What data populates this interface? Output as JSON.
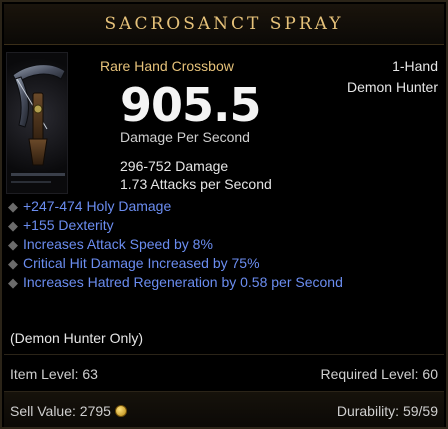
{
  "item": {
    "name": "Sacrosanct Spray",
    "subtype": "Rare Hand Crossbow",
    "handedness": "1-Hand",
    "class": "Demon Hunter",
    "dps": "905.5",
    "dps_label": "Damage Per Second",
    "damage_range": "296-752 Damage",
    "attacks_per_second": "1.73 Attacks per Second",
    "affixes": [
      "+247-474 Holy Damage",
      "+155 Dexterity",
      "Increases Attack Speed by 8%",
      "Critical Hit Damage Increased by 75%",
      "Increases Hatred Regeneration by 0.58 per Second"
    ],
    "class_restriction": "(Demon Hunter Only)",
    "item_level_label": "Item Level: 63",
    "required_level_label": "Required Level: 60",
    "sell_value_label": "Sell Value: 2795",
    "durability_label": "Durability: 59/59"
  },
  "colors": {
    "title": "#e6c27a",
    "affix": "#6b8df0",
    "text": "#e6e6e6",
    "muted": "#cfcfcf",
    "background": "#000000"
  },
  "icons": {
    "currency": "gold-coin-icon",
    "bullet": "diamond-bullet-icon"
  }
}
